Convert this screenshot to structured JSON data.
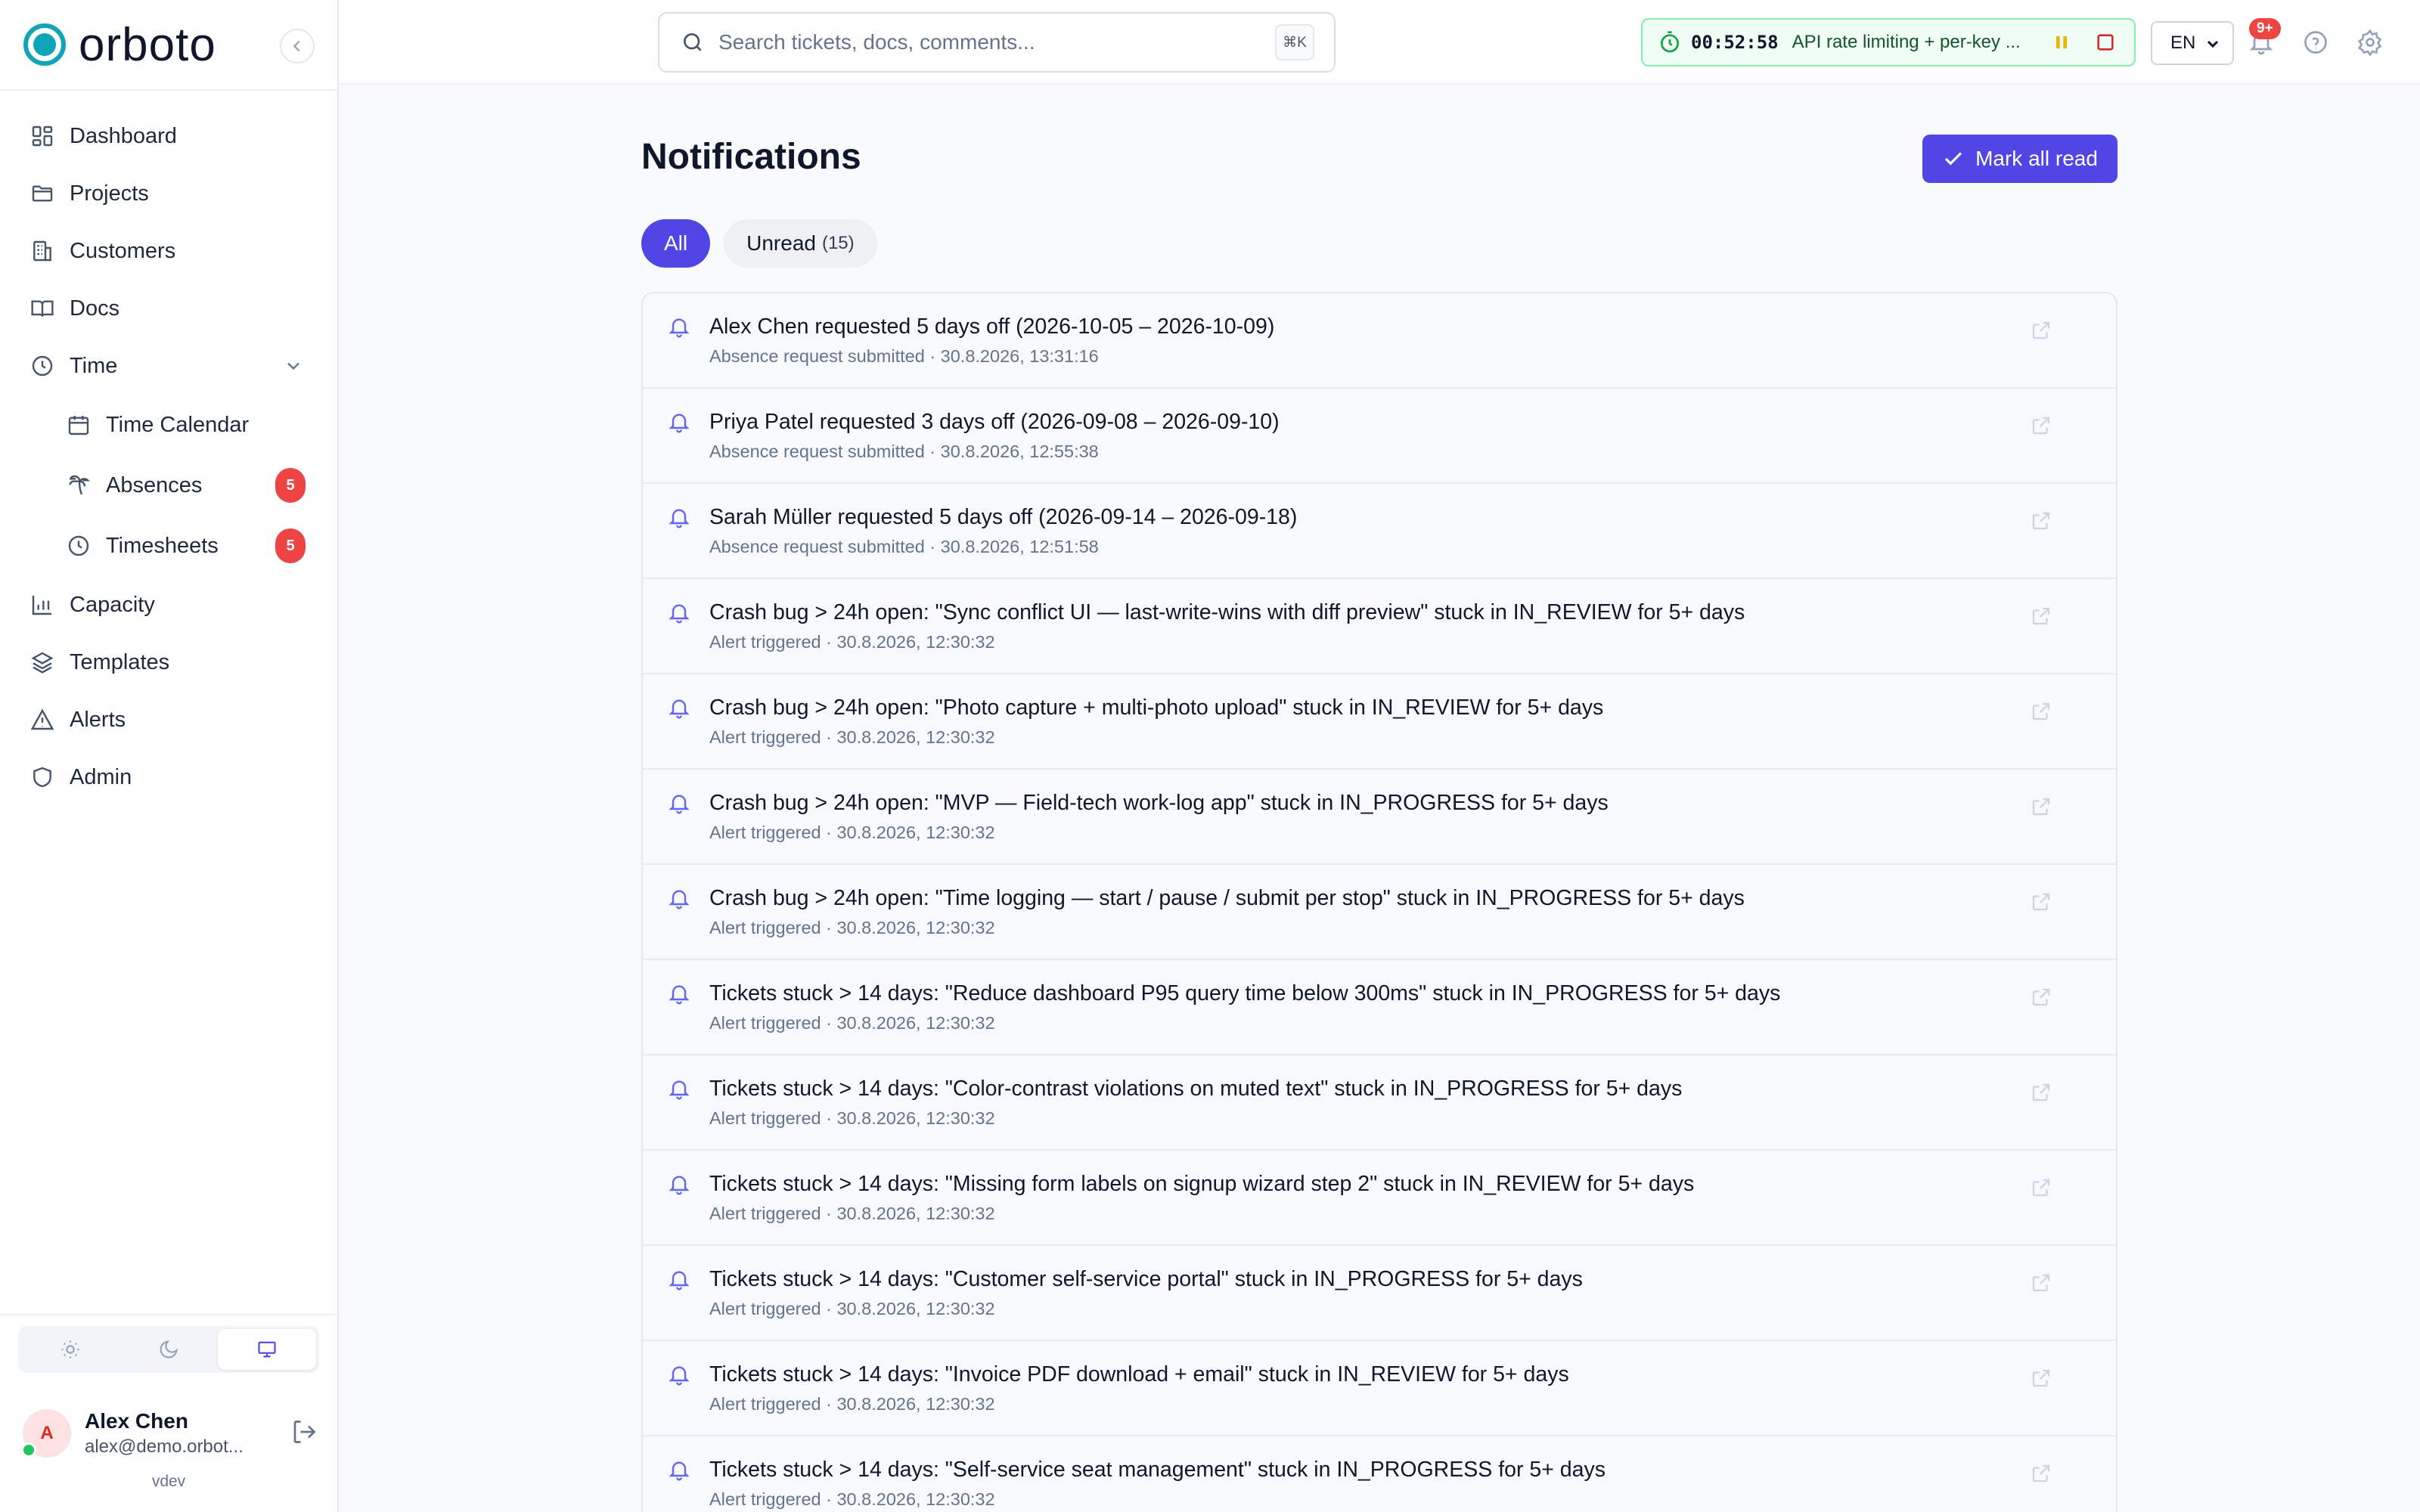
{
  "brand": {
    "name": "orboto"
  },
  "colors": {
    "accent": "#4f46e5",
    "badge": "#ef4444",
    "timer_bg": "#f0fdf4",
    "timer_border": "#86efac"
  },
  "sidebar": {
    "items": [
      {
        "label": "Dashboard",
        "icon": "dashboard-icon"
      },
      {
        "label": "Projects",
        "icon": "folder-icon"
      },
      {
        "label": "Customers",
        "icon": "building-icon"
      },
      {
        "label": "Docs",
        "icon": "book-icon"
      },
      {
        "label": "Time",
        "icon": "clock-icon",
        "expanded": true
      },
      {
        "label": "Time Calendar",
        "icon": "calendar-icon"
      },
      {
        "label": "Absences",
        "icon": "palm-tree-icon",
        "badge": "5"
      },
      {
        "label": "Timesheets",
        "icon": "clock-icon",
        "badge": "5"
      },
      {
        "label": "Capacity",
        "icon": "bar-chart-icon"
      },
      {
        "label": "Templates",
        "icon": "layers-icon"
      },
      {
        "label": "Alerts",
        "icon": "warning-icon"
      },
      {
        "label": "Admin",
        "icon": "shield-icon"
      }
    ],
    "theme_options": [
      "light",
      "dark",
      "system"
    ],
    "theme_selected": "system",
    "user": {
      "initial": "A",
      "name": "Alex Chen",
      "email": "alex@demo.orbot..."
    },
    "version": "vdev"
  },
  "topbar": {
    "search_placeholder": "Search tickets, docs, comments...",
    "search_shortcut": "⌘K",
    "timer": {
      "elapsed": "00:52:58",
      "task": "API rate limiting + per-key ..."
    },
    "language": "EN",
    "notification_badge": "9+"
  },
  "page": {
    "title": "Notifications",
    "mark_all_label": "Mark all read",
    "tabs": [
      {
        "label": "All",
        "active": true
      },
      {
        "label": "Unread",
        "count": "(15)",
        "active": false
      }
    ]
  },
  "notifications": [
    {
      "title": "Alex Chen requested 5 days off (2026-10-05 – 2026-10-09)",
      "meta": "Absence request submitted · 30.8.2026, 13:31:16"
    },
    {
      "title": "Priya Patel requested 3 days off (2026-09-08 – 2026-09-10)",
      "meta": "Absence request submitted · 30.8.2026, 12:55:38"
    },
    {
      "title": "Sarah Müller requested 5 days off (2026-09-14 – 2026-09-18)",
      "meta": "Absence request submitted · 30.8.2026, 12:51:58"
    },
    {
      "title": "Crash bug > 24h open: \"Sync conflict UI — last-write-wins with diff preview\" stuck in IN_REVIEW for 5+ days",
      "meta": "Alert triggered · 30.8.2026, 12:30:32"
    },
    {
      "title": "Crash bug > 24h open: \"Photo capture + multi-photo upload\" stuck in IN_REVIEW for 5+ days",
      "meta": "Alert triggered · 30.8.2026, 12:30:32"
    },
    {
      "title": "Crash bug > 24h open: \"MVP — Field-tech work-log app\" stuck in IN_PROGRESS for 5+ days",
      "meta": "Alert triggered · 30.8.2026, 12:30:32"
    },
    {
      "title": "Crash bug > 24h open: \"Time logging — start / pause / submit per stop\" stuck in IN_PROGRESS for 5+ days",
      "meta": "Alert triggered · 30.8.2026, 12:30:32"
    },
    {
      "title": "Tickets stuck > 14 days: \"Reduce dashboard P95 query time below 300ms\" stuck in IN_PROGRESS for 5+ days",
      "meta": "Alert triggered · 30.8.2026, 12:30:32"
    },
    {
      "title": "Tickets stuck > 14 days: \"Color-contrast violations on muted text\" stuck in IN_PROGRESS for 5+ days",
      "meta": "Alert triggered · 30.8.2026, 12:30:32"
    },
    {
      "title": "Tickets stuck > 14 days: \"Missing form labels on signup wizard step 2\" stuck in IN_REVIEW for 5+ days",
      "meta": "Alert triggered · 30.8.2026, 12:30:32"
    },
    {
      "title": "Tickets stuck > 14 days: \"Customer self-service portal\" stuck in IN_PROGRESS for 5+ days",
      "meta": "Alert triggered · 30.8.2026, 12:30:32"
    },
    {
      "title": "Tickets stuck > 14 days: \"Invoice PDF download + email\" stuck in IN_REVIEW for 5+ days",
      "meta": "Alert triggered · 30.8.2026, 12:30:32"
    },
    {
      "title": "Tickets stuck > 14 days: \"Self-service seat management\" stuck in IN_PROGRESS for 5+ days",
      "meta": "Alert triggered · 30.8.2026, 12:30:32"
    }
  ]
}
